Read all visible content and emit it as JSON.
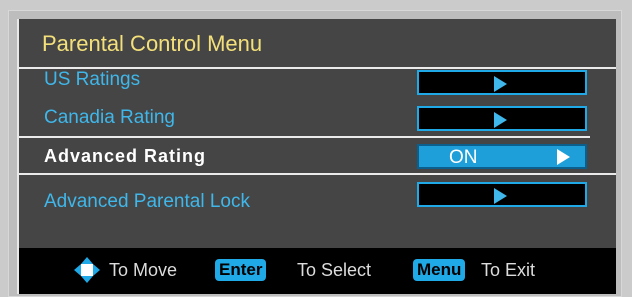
{
  "menu": {
    "title": "Parental Control Menu",
    "items": [
      {
        "label": "US Ratings",
        "value": ""
      },
      {
        "label": "Canadia Rating",
        "value": ""
      },
      {
        "label": "Advanced Rating",
        "value": "ON",
        "selected": true
      },
      {
        "label": "Advanced Parental Lock",
        "value": ""
      }
    ]
  },
  "footer": {
    "move_label": "To Move",
    "enter_key": "Enter",
    "select_label": "To Select",
    "menu_key": "Menu",
    "exit_label": "To Exit"
  },
  "colors": {
    "title": "#f3e07a",
    "label": "#3fb7ea",
    "selected_label": "#ffffff",
    "accent": "#1fa9e6",
    "panel": "#454545"
  },
  "icons": [
    "direction-pad-icon",
    "arrow-right-icon"
  ]
}
